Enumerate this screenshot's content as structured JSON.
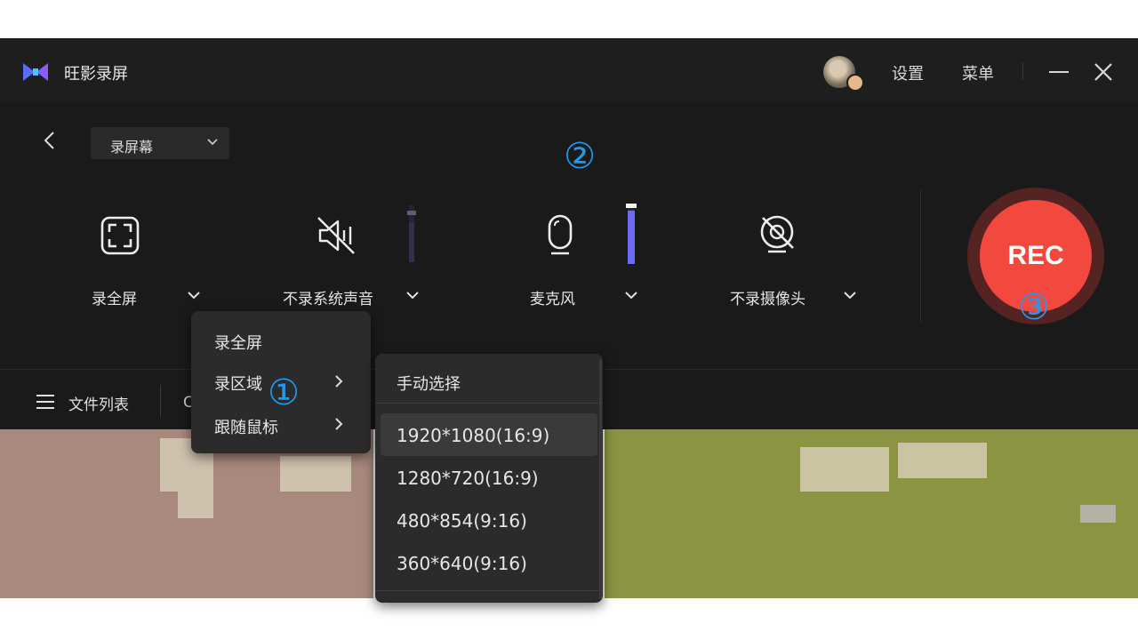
{
  "app": {
    "title": "旺影录屏",
    "settings_label": "设置",
    "menu_label": "菜单"
  },
  "mode_select": {
    "value": "录屏幕"
  },
  "controls": {
    "screen": {
      "label": "录全屏",
      "icon": "fullscreen-icon"
    },
    "system_audio": {
      "label": "不录系统声音",
      "icon": "speaker-muted-icon"
    },
    "microphone": {
      "label": "麦克风",
      "icon": "microphone-icon"
    },
    "camera": {
      "label": "不录摄像头",
      "icon": "camera-off-icon"
    }
  },
  "rec_button": {
    "label": "REC",
    "color": "#f2483e"
  },
  "bottom_bar": {
    "file_list_label": "文件列表",
    "partial_text": "C"
  },
  "annotations": {
    "step1": "①",
    "step2": "②",
    "step3": "③",
    "color": "#1e9bf0"
  },
  "record_mode_menu": {
    "items": [
      "录全屏",
      "录区域",
      "跟随鼠标"
    ]
  },
  "region_submenu": {
    "manual": "手动选择",
    "resolutions": [
      "1920*1080(16:9)",
      "1280*720(16:9)",
      "480*854(9:16)",
      "360*640(9:16)"
    ],
    "highlighted_index": 0
  },
  "colors": {
    "window_bg": "#1a1a1a",
    "mic_level": "#6a6cf0",
    "accent_logo": "#5a6cff"
  }
}
